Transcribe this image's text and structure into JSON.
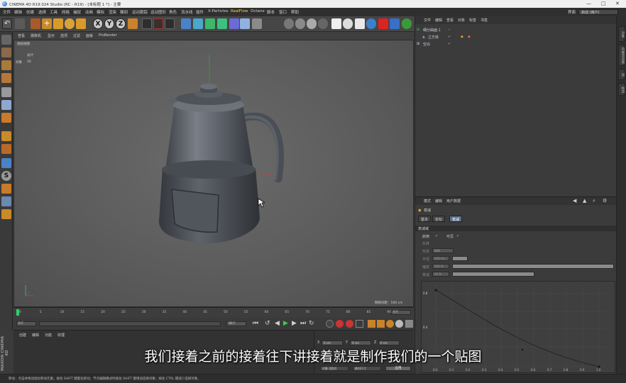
{
  "window": {
    "title": "CINEMA 4D R19.024 Studio (RC - R19) - [未标题 1 *] - 主要",
    "controls": [
      "—",
      "□",
      "✕"
    ]
  },
  "menubar": {
    "items": [
      "文件",
      "编辑",
      "创建",
      "选择",
      "工具",
      "网格",
      "捕捉",
      "动画",
      "模拟",
      "渲染",
      "雕刻",
      "运动跟踪",
      "运动图形",
      "角色",
      "流水线",
      "插件",
      "X-Particles",
      "RealFlow",
      "Octane",
      "脚本",
      "窗口",
      "帮助"
    ],
    "highlight": "RealFlow",
    "layout_label": "界面",
    "layout_value": "启动 (用户)"
  },
  "toolbar": {
    "axis_x": "X",
    "axis_y": "Y",
    "axis_z": "Z"
  },
  "viewport": {
    "menu": [
      "查看",
      "摄像机",
      "显示",
      "选项",
      "过滤",
      "面板",
      "ProRender"
    ],
    "camera_label": "透视视图",
    "hud_line1": "总计",
    "hud_line2a": "对象",
    "hud_line2b": "16",
    "grid_spacing": "网格间距：100 cm"
  },
  "timeline": {
    "ticks": [
      "0",
      "5",
      "10",
      "15",
      "20",
      "25",
      "30",
      "35",
      "40",
      "45",
      "50",
      "55",
      "60",
      "65",
      "70",
      "75",
      "80",
      "85",
      "90"
    ],
    "end_frame": "0 F",
    "current_start": "0 F",
    "range_end": "90 F",
    "field_left": "0 F"
  },
  "material_manager": {
    "menu": [
      "创建",
      "编辑",
      "功能",
      "纹理"
    ]
  },
  "coord_manager": {
    "labels": [
      "X",
      "Y",
      "Z"
    ],
    "values": [
      "0 cm",
      "0 cm",
      "0 cm"
    ],
    "dropdown1": "对象 (相对)",
    "dropdown2": "绝对尺寸",
    "apply": "应用"
  },
  "object_manager": {
    "menu": [
      "文件",
      "编辑",
      "查看",
      "对象",
      "标签",
      "书签"
    ],
    "rows": [
      {
        "name": "细分曲面.1",
        "indent": 1
      },
      {
        "name": "立方体",
        "indent": 2
      },
      {
        "name": "空白",
        "indent": 0
      }
    ]
  },
  "attribute_manager": {
    "menu": [
      "模式",
      "编辑",
      "用户数据"
    ],
    "object_type": "衰减",
    "tabs": [
      "基本",
      "坐标",
      "衰减"
    ],
    "active_tab": "衰减",
    "section": "衰减域",
    "rows": [
      {
        "label": "启用",
        "value": "✓"
      },
      {
        "label": "反转",
        "value": ""
      },
      {
        "label": "可见",
        "value": "✓"
      },
      {
        "label": "形状",
        "value": "球体"
      },
      {
        "label": "半径",
        "value": "100 cm"
      },
      {
        "label": "缩放",
        "value": "100 %"
      },
      {
        "label": "衰减",
        "value": "20 %"
      }
    ],
    "curve_x_ticks": [
      "0.0",
      "0.1",
      "0.2",
      "0.3",
      "0.4",
      "0.5",
      "0.6",
      "0.7",
      "0.8",
      "0.9",
      "1.0"
    ],
    "curve_y_ticks": [
      "0.8",
      "0.4"
    ]
  },
  "right_strip": {
    "tabs": [
      "对象",
      "内容浏览器",
      "层",
      "构造"
    ]
  },
  "statusbar": {
    "text": "移动：点击并拖动鼠标移动元素。按住 SHIFT 键量化移动；节点编辑模式时按住 SHIFT 键增加选择对象；按住 CTRL 键减少选择对象。"
  },
  "branding": "MAXON CINEMA 4D",
  "subtitle": "我们接着之前的接着往下讲接着就是制作我们的一个贴图"
}
